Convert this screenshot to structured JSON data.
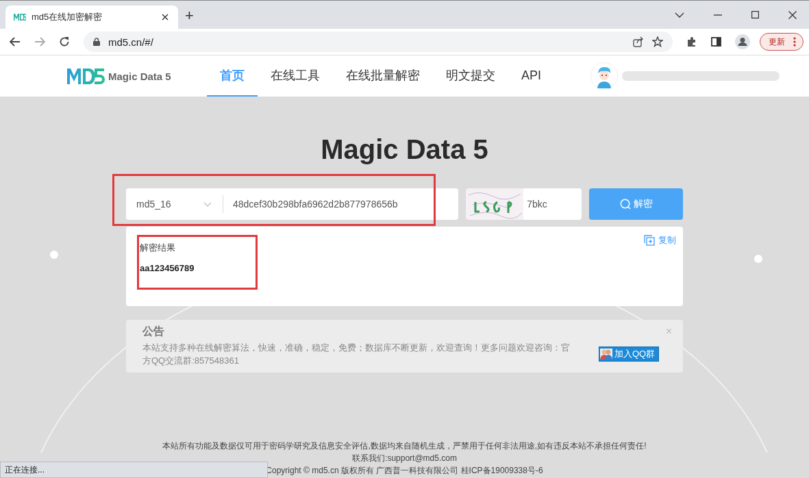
{
  "browser": {
    "tabs": [
      {
        "title": "md5在线加密解密",
        "selected": true
      }
    ],
    "new_tab": "+",
    "url": "md5.cn/#/",
    "update_button": "更新"
  },
  "header": {
    "logo_text": "Magic Data 5",
    "nav": [
      {
        "label": "首页",
        "selected": true
      },
      {
        "label": "在线工具",
        "selected": false
      },
      {
        "label": "在线批量解密",
        "selected": false
      },
      {
        "label": "明文提交",
        "selected": false
      },
      {
        "label": "API",
        "selected": false
      }
    ]
  },
  "hero_title": "Magic Data 5",
  "search": {
    "algorithm": "md5_16",
    "hash": "48dcef30b298bfa6962d2b877978656b",
    "captcha": "7bkc",
    "submit": "解密"
  },
  "result": {
    "label": "解密结果",
    "value": "aa123456789",
    "copy": "复制"
  },
  "notice": {
    "title": "公告",
    "text": "本站支持多种在线解密算法，快速，准确，稳定，免费；数据库不断更新，欢迎查询！更多问题欢迎咨询：官方QQ交流群:857548361",
    "close": "×",
    "qq_button": "加入QQ群"
  },
  "footer": [
    "本站所有功能及数据仅可用于密码学研究及信息安全评估,数据均来自随机生成，严禁用于任何非法用途,如有违反本站不承担任何责任!",
    "联系我们:support@md5.com",
    "Copyright © md5.cn 版权所有 广西普一科技有限公司 桂ICP备19009338号-6"
  ],
  "status_bar": "正在连接..."
}
